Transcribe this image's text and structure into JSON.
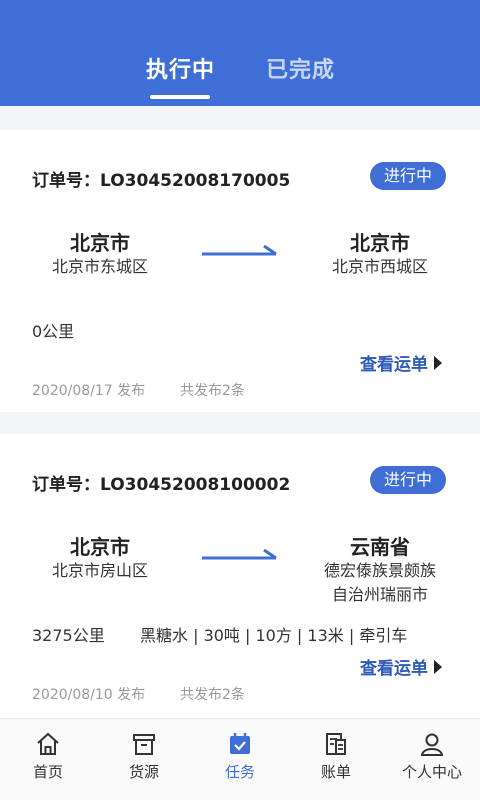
{
  "tabs": [
    {
      "label": "执行中",
      "active": true
    },
    {
      "label": "已完成",
      "active": false
    }
  ],
  "orders": [
    {
      "order_label": "订单号：",
      "order_no": "LO30452008170005",
      "status": "进行中",
      "from_city": "北京市",
      "from_district": "北京市东城区",
      "to_city": "北京市",
      "to_district_line1": "北京市西城区",
      "to_district_line2": "",
      "distance": "0公里",
      "cargo": "",
      "view_label": "查看运单",
      "date": "2020/08/17 发布",
      "count": "共发布2条"
    },
    {
      "order_label": "订单号：",
      "order_no": "LO30452008100002",
      "status": "进行中",
      "from_city": "北京市",
      "from_district": "北京市房山区",
      "to_city": "云南省",
      "to_district_line1": "德宏傣族景颇族",
      "to_district_line2": "自治州瑞丽市",
      "distance": "3275公里",
      "cargo": "黑糖水 | 30吨 | 10方 | 13米 | 牵引车",
      "view_label": "查看运单",
      "date": "2020/08/10 发布",
      "count": "共发布2条"
    }
  ],
  "nav": [
    {
      "label": "首页",
      "icon": "home-icon",
      "active": false
    },
    {
      "label": "货源",
      "icon": "box-icon",
      "active": false
    },
    {
      "label": "任务",
      "icon": "task-calendar-icon",
      "active": true
    },
    {
      "label": "账单",
      "icon": "bill-icon",
      "active": false
    },
    {
      "label": "个人中心",
      "icon": "user-icon",
      "active": false
    }
  ],
  "colors": {
    "primary": "#3f6fd6",
    "link": "#2e5bb8"
  }
}
